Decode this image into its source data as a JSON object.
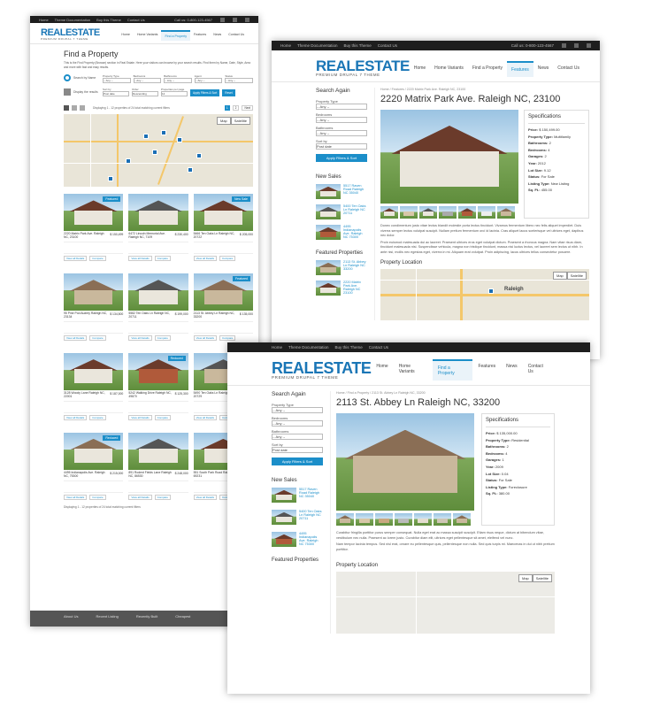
{
  "theme": {
    "accent": "#1b8ec9",
    "brand": "#1a76b6"
  },
  "topbar": {
    "links": [
      "Home",
      "Theme Documentation",
      "Buy this Theme",
      "Contact Us"
    ],
    "phone": "Call us: 0-800-123-4567"
  },
  "logo": {
    "main": "REALESTATE",
    "tag": "PREMIUM DRUPAL 7 THEME"
  },
  "nav": [
    "Home",
    "Home Variants",
    "Find a Property",
    "Features",
    "News",
    "Contact Us"
  ],
  "listing": {
    "title": "Find a Property",
    "intro": "This is the Find Property (Browse) section in Real Estate. Here your visitors can browse by your search results. Find them by Name, Date, Style, Area and more with fast and easy results.",
    "search_label": "Search by Name",
    "display_label": "Display the results",
    "filters": [
      {
        "label": "Property Type",
        "value": "-- Any --"
      },
      {
        "label": "Bedrooms",
        "value": "-- Any --"
      },
      {
        "label": "Bathrooms",
        "value": "-- Any --"
      },
      {
        "label": "Agent",
        "value": "-- Any --"
      },
      {
        "label": "Status",
        "value": "-- Any --"
      }
    ],
    "sort": [
      {
        "label": "Sort by",
        "value": "Post date"
      },
      {
        "label": "Order",
        "value": "Descending"
      },
      {
        "label": "Properties per page",
        "value": "12"
      }
    ],
    "apply": "Apply Filters & Sort",
    "reset": "Reset",
    "count_text": "Displaying 1 - 12 properties of 24 total matching current filters",
    "pages": [
      "1",
      "2"
    ],
    "next": "Next",
    "footer_count": "Displaying 1 - 12 properties of 24 total matching current filters",
    "cards": [
      {
        "title": "2220 Matrix Park Ave. Raleigh NC, 23100",
        "price": "$ 150,499",
        "badge": "Featured"
      },
      {
        "title": "6472 Lincoln Memorial Ave. Raleigh NC, 7109",
        "price": "$ 230,400",
        "badge": ""
      },
      {
        "title": "5466 Ten Oaks Ln Raleigh NC, 20722",
        "price": "$ 205,000",
        "badge": "New Sale"
      },
      {
        "title": "95 Pine Pod Audrey Raleigh NC, 23134",
        "price": "$ 134,500",
        "badge": ""
      },
      {
        "title": "5582 Ten Oaks Ln Raleigh NC, 20711",
        "price": "$ 199,000",
        "badge": ""
      },
      {
        "title": "2113 St. Abbey Ln Raleigh NC, 33200",
        "price": "$ 135,000",
        "badge": "Featured"
      },
      {
        "title": "3128 Woody Lane Raleigh NC, 22001",
        "price": "$ 187,000",
        "badge": ""
      },
      {
        "title": "5242 Walking Drive Raleigh NC, 49870",
        "price": "$ 125,300",
        "badge": "Reduced"
      },
      {
        "title": "5490 Ten Oaks Ln Raleigh NC, 20729",
        "price": "$ 176,000",
        "badge": ""
      },
      {
        "title": "4495 Indianapolis Ave. Raleigh NC, 75300",
        "price": "$ 215,000",
        "badge": "Reduced"
      },
      {
        "title": "891 Rodent Fields Lane Raleigh NC, 86530",
        "price": "$ 248,000",
        "badge": ""
      },
      {
        "title": "551 South Park Road Raleigh NC, 69231",
        "price": "$ 181,000",
        "badge": ""
      }
    ],
    "view_details": "View all Details",
    "compare": "Compare"
  },
  "detail1": {
    "breadcrumb": "Home / Features / 2220 Matrix Park Ave. Raleigh NC, 23100",
    "title": "2220 Matrix Park Ave. Raleigh NC, 23100",
    "search_again": "Search Again",
    "fields": [
      {
        "label": "Property Type",
        "value": "-- Any --"
      },
      {
        "label": "Bedrooms",
        "value": "-- Any --"
      },
      {
        "label": "Bathrooms",
        "value": "-- Any --"
      },
      {
        "label": "Sort by",
        "value": "Post date"
      }
    ],
    "apply": "Apply Filters & Sort",
    "new_sales_h": "New Sales",
    "new_sales": [
      "5517 Raven Road Raleigh NC 35040",
      "5400 Ten Oaks Ln Raleigh NC 20711",
      "4495 Indianapolis Ave. Raleigh NC 75300"
    ],
    "featured_h": "Featured Properties",
    "featured": [
      "2113 St. Abbey Ln Raleigh NC 33200",
      "2220 Matrix Park Ave. Raleigh NC 23100"
    ],
    "specs_h": "Specifications",
    "specs": [
      [
        "Price:",
        "$ 150,499.00"
      ],
      [
        "Property Type:",
        "Multifamily"
      ],
      [
        "Bathrooms:",
        "2"
      ],
      [
        "Bedrooms:",
        "4"
      ],
      [
        "Garages:",
        "2"
      ],
      [
        "Year:",
        "2012"
      ],
      [
        "Lot Size:",
        "9.12"
      ],
      [
        "Status:",
        "For Sale"
      ],
      [
        "Listing Type:",
        "New Listing"
      ],
      [
        "Sq. Ft.:",
        "455.00"
      ]
    ],
    "para1": "Donec condimentum justo vitae lectus blandit molestie porta lectus tincidunt. Vivamus fermentum libero nec felis aliquet imperdiet. Duis viverra semper lectus volutpat suscipit. Nullam pretium fermentum orci id lacinia. Cras aliquet lacus scelerisque vel ultrices eget, dapibus nec dolor.",
    "para2": "Proin euismod malesuada dui ac laoreet. Praesent ultrices eros eget volutpat dictum. Praesent a rhoncus magna. Nam vitae risus diam, tincidunt malesuada nisi. Suspendisse vehicula, magna non tristique tincidunt, massa nisi luctus lectus, vel laoreet sem lectus ut nibh. In ante nisi, mollis nec egestas eget, viverra in mi. Aliquam erat volutpat. Proin adipiscing, lacus ultrices tellus consectetur posuere.",
    "location_h": "Property Location",
    "map_btns": [
      "Map",
      "Satellite"
    ],
    "city": "Raleigh"
  },
  "detail2": {
    "breadcrumb": "Home / Find a Property / 2113 St. Abbey Ln Raleigh NC, 33200",
    "title": "2113 St. Abbey Ln Raleigh NC, 33200",
    "search_again": "Search Again",
    "fields": [
      {
        "label": "Property Type",
        "value": "-- Any --"
      },
      {
        "label": "Bedrooms",
        "value": "-- Any --"
      },
      {
        "label": "Bathrooms",
        "value": "-- Any --"
      },
      {
        "label": "Sort by",
        "value": "Post date"
      }
    ],
    "apply": "Apply Filters & Sort",
    "new_sales_h": "New Sales",
    "new_sales": [
      "5517 Raven Road Raleigh NC 35040",
      "5400 Ten Oaks Ln Raleigh NC 20711",
      "4495 Indianapolis Ave. Raleigh NC 75300"
    ],
    "featured_h": "Featured Properties",
    "specs_h": "Specifications",
    "specs": [
      [
        "Price:",
        "$ 135,000.00"
      ],
      [
        "Property Type:",
        "Residential"
      ],
      [
        "Bathrooms:",
        "2"
      ],
      [
        "Bedrooms:",
        "4"
      ],
      [
        "Garages:",
        "1"
      ],
      [
        "Year:",
        "2009"
      ],
      [
        "Lot Size:",
        "0.04"
      ],
      [
        "Status:",
        "For Sale"
      ],
      [
        "Listing Type:",
        "Foreclosure"
      ],
      [
        "Sq. Ft.:",
        "380.00"
      ]
    ],
    "para1": "Curabitur fringilla porttitor purus semper consequat. Nulla eget erat ac massa suscipit suscipit. Etiam risus neque, dictum at bibendum vitae, vestibulum nec nulla. Praesent ac lorem justo. Curabitur diam elit, ultrices eget pellentesque sit amet, eleifend vel nunc.",
    "para2": "Nam tempor lacinia tempus. Sed nisl erat, ornare eu pellentesque quis, pellentesque non nulla. Sed quis turpis mi. Maecenas in dui ut nibh pretium porttitor.",
    "location_h": "Property Location",
    "map_btns": [
      "Map",
      "Satellite"
    ]
  },
  "footer": {
    "cols": [
      "About Us",
      "Recent Listing",
      "Recently Built",
      "Cheapest"
    ]
  }
}
